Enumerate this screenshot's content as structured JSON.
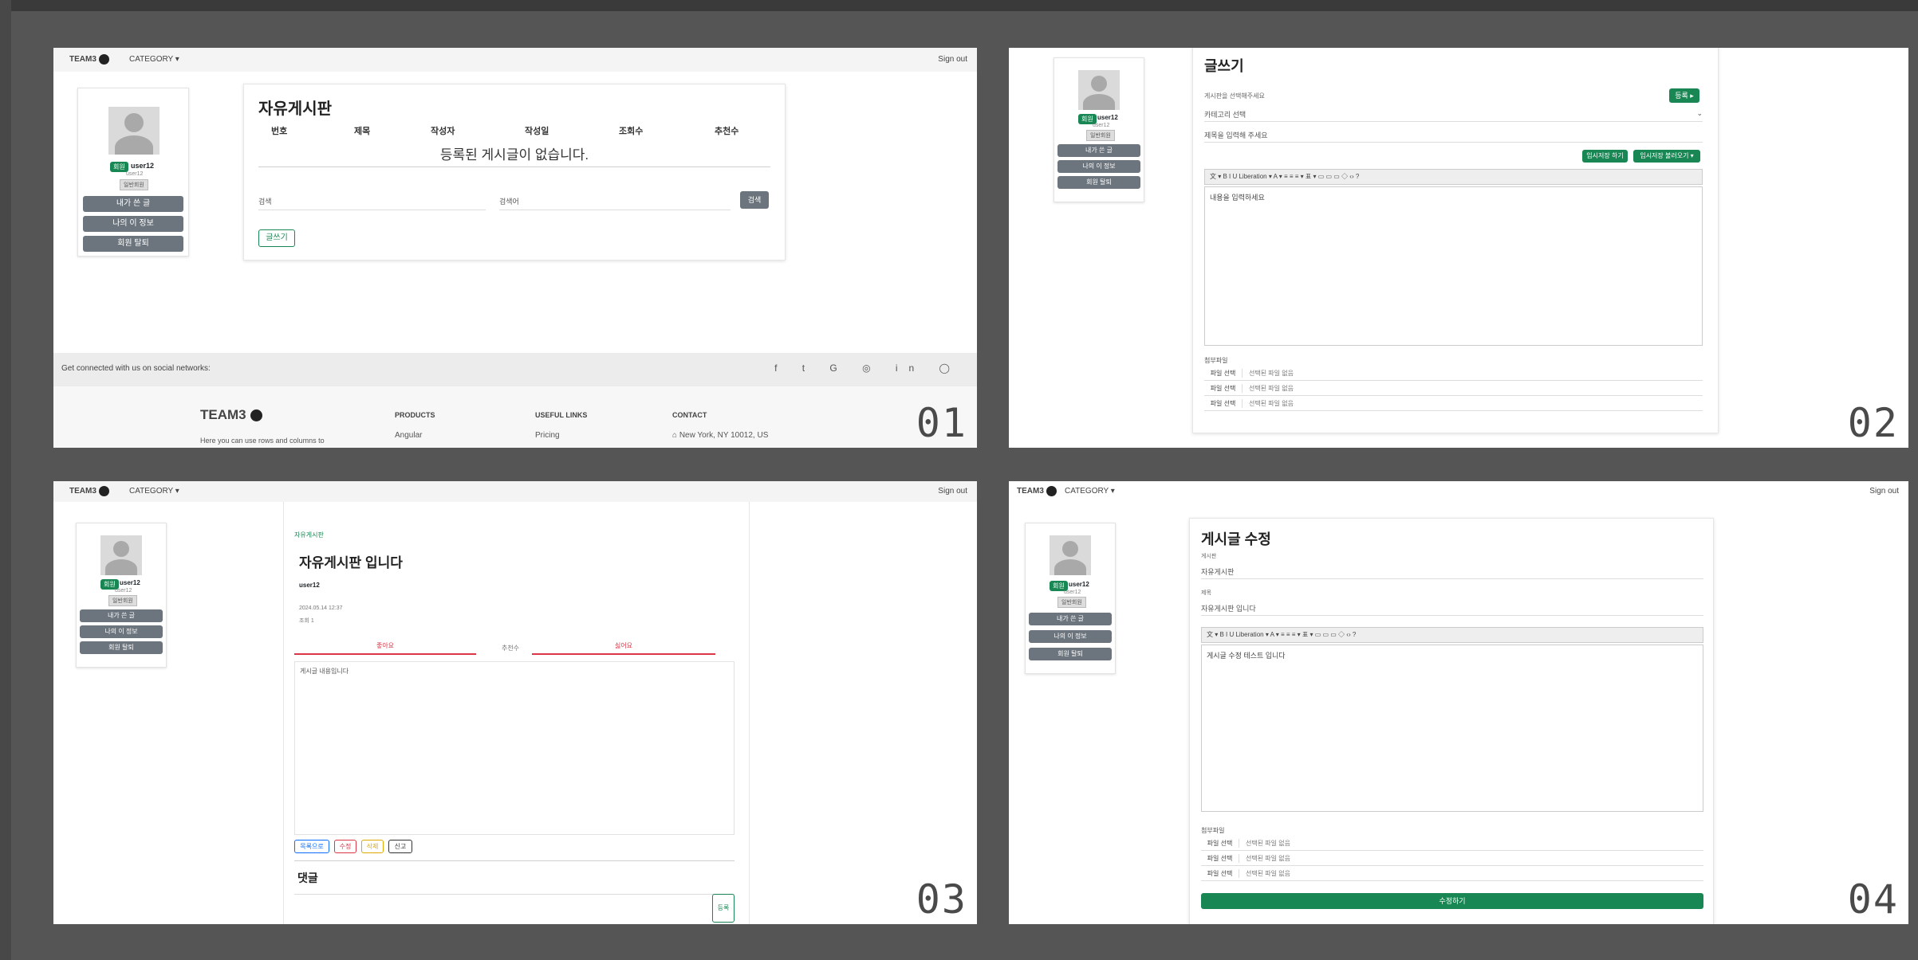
{
  "nav": {
    "brand": "TEAM3",
    "category": "CATEGORY ▾",
    "signout": "Sign out"
  },
  "profile": {
    "badge": "회원",
    "username": "user12",
    "sub": "user12",
    "grade": "일반회원",
    "buttons": [
      "내가 쓴 글",
      "나의 이 정보",
      "회원 탈퇴"
    ]
  },
  "panel1": {
    "number": "01",
    "title": "자유게시판",
    "columns": [
      "번호",
      "제목",
      "작성자",
      "작성일",
      "조회수",
      "추천수"
    ],
    "empty": "등록된 게시글이 없습니다.",
    "search_left": "검색",
    "search_mid": "검색어",
    "search_button": "검색",
    "write_button": "글쓰기",
    "social_text": "Get connected with us on social networks:",
    "social_icons": "f  t  G  ◎  in  ◯",
    "footer_brand": "TEAM3",
    "footer_tagline": "Here you can use rows and columns to",
    "products_head": "PRODUCTS",
    "products_item": "Angular",
    "links_head": "USEFUL LINKS",
    "links_item": "Pricing",
    "contact_head": "CONTACT",
    "contact_item": "New York, NY 10012, US"
  },
  "panel2": {
    "number": "02",
    "title": "글쓰기",
    "cat_label": "게시판을 선택해주세요",
    "cat_button": "등록 ▸",
    "select_value": "카테고리 선택",
    "title_placeholder": "제목을 입력해 주세요",
    "btn_temp": "임시저장 하기",
    "btn_load": "임시저장 불러오기 ▾",
    "toolbar": "文 ▾  B  I  U  Liberation ▾  A ▾  ≡  ≡  ≡ ▾  표 ▾  ▭  ▭  ▭  ◇  ‹›  ?",
    "editor_text": "내용을 입력하세요",
    "file_label": "첨부파일",
    "file_rows": [
      [
        "파일 선택",
        "선택된 파일 없음"
      ],
      [
        "파일 선택",
        "선택된 파일 없음"
      ],
      [
        "파일 선택",
        "선택된 파일 없음"
      ]
    ]
  },
  "panel3": {
    "number": "03",
    "breadcrumb": "자유게시판",
    "title": "자유게시판 입니다",
    "author": "user12",
    "date": "2024.05.14 12:37",
    "views": "조회 1",
    "like_label": "좋아요",
    "mid_label": "추천수",
    "dislike_label": "싫어요",
    "content": "게시글 내용입니다",
    "tags": [
      "목록으로",
      "수정",
      "삭제",
      "신고"
    ],
    "comment_title": "댓글",
    "comment_button": "등록"
  },
  "panel4": {
    "number": "04",
    "title": "게시글 수정",
    "cat_label": "게시판",
    "cat_value": "자유게시판",
    "title_label": "제목",
    "title_value": "자유게시판 입니다",
    "toolbar": "文 ▾  B  I  U  Liberation ▾  A ▾  ≡  ≡  ≡ ▾  표 ▾  ▭  ▭  ▭  ◇  ‹›  ?",
    "editor_text": "게시글 수정 테스트 입니다",
    "file_label": "첨부파일",
    "file_rows": [
      [
        "파일 선택",
        "선택된 파일 없음"
      ],
      [
        "파일 선택",
        "선택된 파일 없음"
      ],
      [
        "파일 선택",
        "선택된 파일 없음"
      ]
    ],
    "submit": "수정하기"
  }
}
